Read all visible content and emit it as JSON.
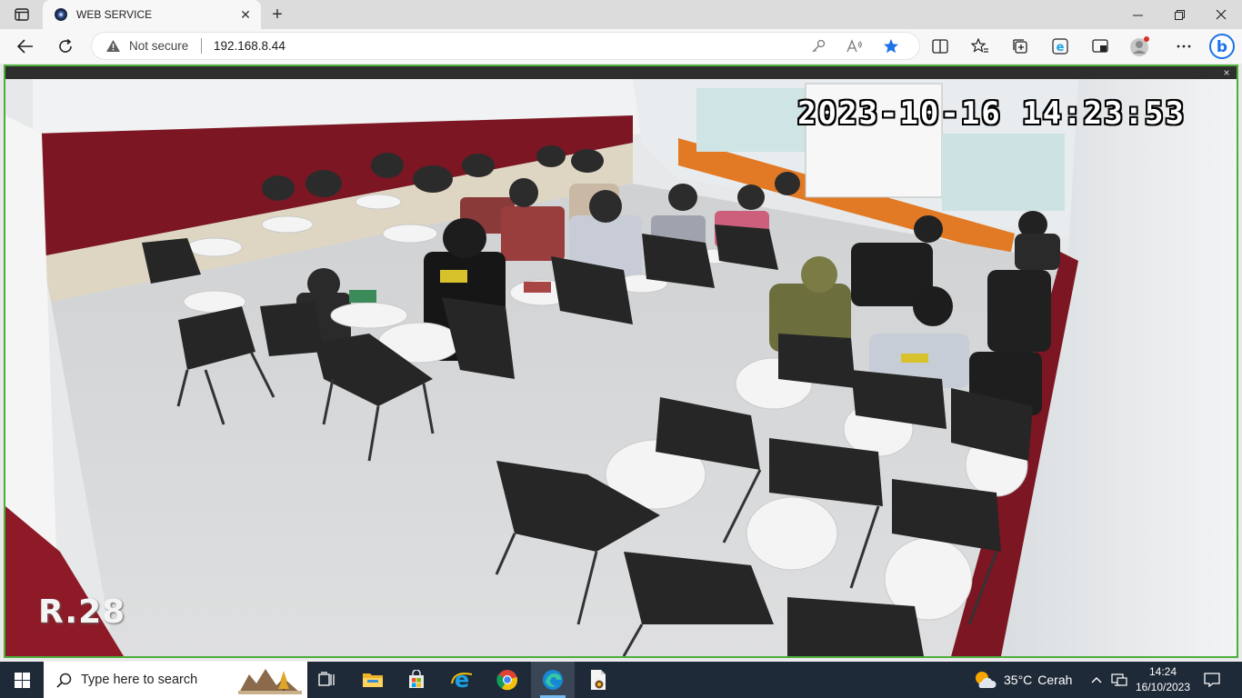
{
  "browser": {
    "tab": {
      "title": "WEB SERVICE",
      "close_glyph": "✕"
    },
    "new_tab_glyph": "+",
    "address": {
      "security_text": "Not secure",
      "url": "192.168.8.44"
    },
    "icons": [
      "tab-actions-icon",
      "back-icon",
      "refresh-icon",
      "key-icon",
      "read-aloud-icon",
      "favorite-star-icon",
      "split-screen-icon",
      "favorites-icon",
      "collections-icon",
      "ie-mode-icon",
      "performance-icon",
      "profile-icon",
      "more-icon",
      "bing-chat-icon"
    ],
    "accent": "#1a73e8"
  },
  "viewer": {
    "close_glyph": "×",
    "timestamp": "2023-10-16 14:23:53",
    "room_label": "R.28",
    "frame_color": "#4caf3c"
  },
  "taskbar": {
    "search_placeholder": "Type here to search",
    "weather": {
      "temp": "35°C",
      "condition": "Cerah"
    },
    "clock": {
      "time": "14:24",
      "date": "16/10/2023"
    },
    "apps": [
      "task-view-icon",
      "file-explorer-icon",
      "store-icon",
      "internet-explorer-icon",
      "chrome-icon",
      "edge-icon",
      "camera-viewer-icon"
    ]
  }
}
